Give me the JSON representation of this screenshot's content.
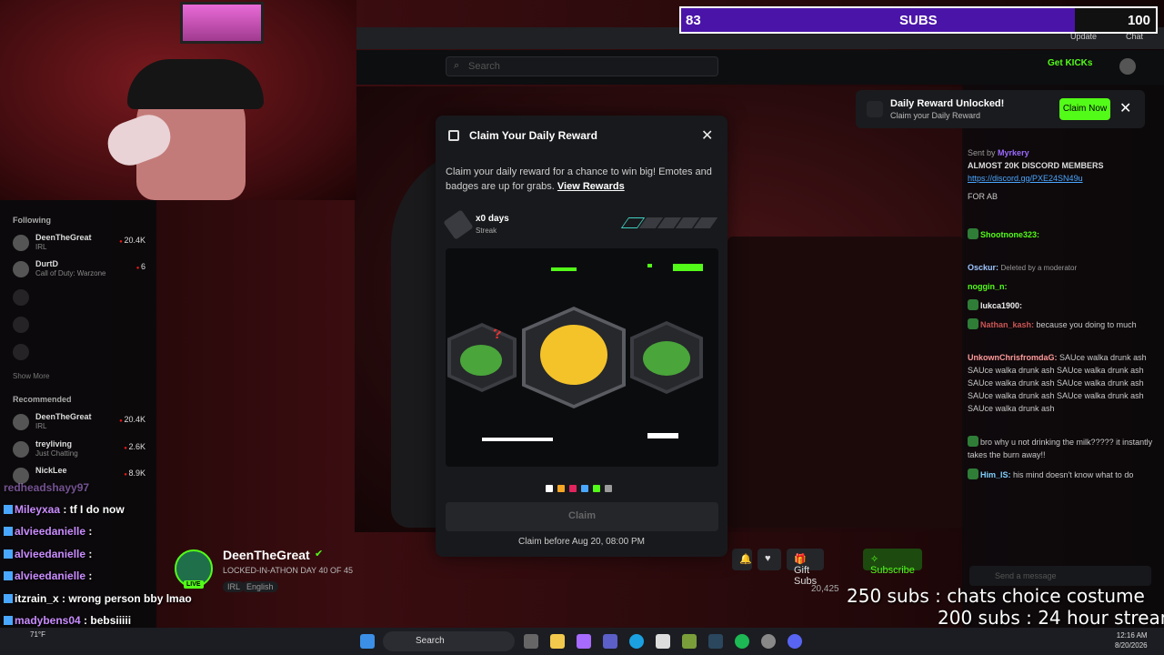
{
  "subs_bar": {
    "current": "83",
    "label": "SUBS",
    "goal": "100",
    "progress": 0.83
  },
  "browser": {
    "update_label": "Update",
    "chat_label": "Chat"
  },
  "header": {
    "search_placeholder": "Search",
    "get_kicks": "Get KICKs"
  },
  "sidebar": {
    "following_title": "Following",
    "following": [
      {
        "name": "DeenTheGreat",
        "sub": "IRL",
        "count": "20.4K"
      },
      {
        "name": "DurtD",
        "sub": "Call of Duty: Warzone",
        "count": "6"
      },
      {
        "name": "",
        "sub": "",
        "count": ""
      },
      {
        "name": "",
        "sub": "",
        "count": ""
      },
      {
        "name": "",
        "sub": "",
        "count": ""
      }
    ],
    "show_more": "Show More",
    "recommended_title": "Recommended",
    "recommended": [
      {
        "name": "DeenTheGreat",
        "sub": "IRL",
        "count": "20.4K"
      },
      {
        "name": "treyliving",
        "sub": "Just Chatting",
        "count": "2.6K"
      },
      {
        "name": "NickLee",
        "sub": "",
        "count": "8.9K"
      }
    ]
  },
  "overlay_chat": [
    {
      "user": "redheadshayy97",
      "text": ""
    },
    {
      "user": "Mileyxaa",
      "text": ": tf I do now"
    },
    {
      "user": "alvieedanielle",
      "text": ":"
    },
    {
      "user": "alvieedanielle",
      "text": ":"
    },
    {
      "user": "alvieedanielle",
      "text": ":"
    },
    {
      "user": "itzrain_x",
      "text": ": wrong person bby lmao"
    },
    {
      "user": "madybens04",
      "text": ": bebsiiiii"
    },
    {
      "user": "Mileyxaa",
      "text": ":"
    }
  ],
  "streamer": {
    "name": "DeenTheGreat",
    "title": "LOCKED-IN-ATHON DAY 40 OF 45",
    "category": "IRL",
    "language": "English",
    "viewers": "20,425",
    "live_badge": "LIVE"
  },
  "actions": {
    "gift_subs": "Gift Subs",
    "subscribe": "Subscribe"
  },
  "toast": {
    "title": "Daily Reward Unlocked!",
    "subtitle": "Claim your Daily Reward",
    "button": "Claim Now"
  },
  "modal": {
    "title": "Claim Your Daily Reward",
    "description": "Claim your daily reward for a chance to win big! Emotes and badges are up for grabs.",
    "view_rewards": "View Rewards",
    "streak_days": "x0 days",
    "streak_label": "Streak",
    "streak_filled": 1,
    "streak_total": 5,
    "claim_button": "Claim",
    "claim_before": "Claim before Aug 20, 08:00 PM",
    "rarity_colors": [
      "#ffffff",
      "#f5a623",
      "#e0245e",
      "#4aa7ff",
      "#53fc18",
      "#9b9b9b"
    ]
  },
  "chat": {
    "pinned_by": "Sent by",
    "pinned_user": "Myrkery",
    "pinned_text": "ALMOST 20K DISCORD MEMBERS",
    "pinned_link": "https://discord.gg/PXE24SN49u",
    "messages": [
      {
        "user": "",
        "text": "FOR AB"
      },
      {
        "user": "Shootnone323:",
        "text": ""
      },
      {
        "user": "Osckur:",
        "text": "Deleted by a moderator"
      },
      {
        "user": "noggin_n:",
        "text": ""
      },
      {
        "user": "lukca1900:",
        "text": ""
      },
      {
        "user": "Nathan_kash:",
        "text": "because you doing to much"
      },
      {
        "user": "UnkownChrisfromdaG:",
        "text": "SAUce walka drunk ash  SAUce walka drunk ash  SAUce walka drunk ash  SAUce walka drunk ash  SAUce walka drunk ash  SAUce walka drunk ash  SAUce walka drunk ash  SAUce walka drunk ash"
      },
      {
        "user": "",
        "text": "bro why u not drinking the milk????? it instantly takes the burn away!!"
      },
      {
        "user": "Him_IS:",
        "text": "his mind doesn't know what to do"
      }
    ],
    "send_placeholder": "Send a message"
  },
  "overlay_text": {
    "line1": "250 subs : chats choice costume",
    "line2": "200 subs : 24 hour stream"
  },
  "taskbar": {
    "search": "Search",
    "weather": "71°F",
    "time": "12:16 AM",
    "date": "8/20/2026"
  }
}
